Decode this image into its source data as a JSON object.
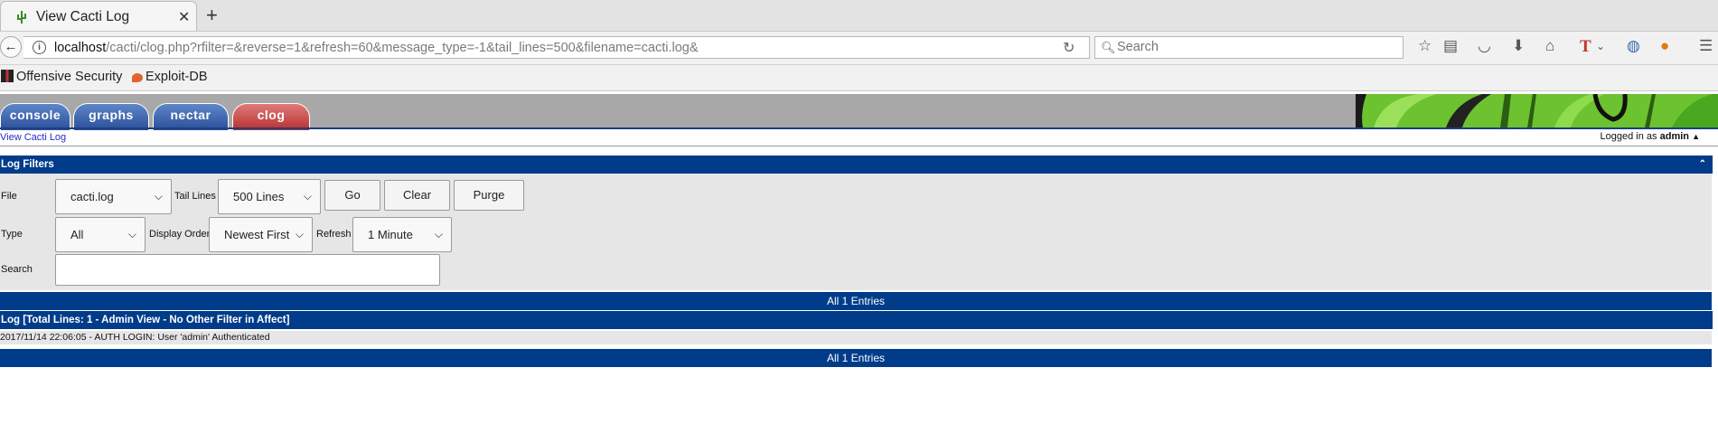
{
  "browser": {
    "tab_title": "View Cacti Log",
    "new_tab": "+",
    "close": "✕",
    "url_host": "localhost",
    "url_path": "/cacti/clog.php?rfilter=&reverse=1&refresh=60&message_type=-1&tail_lines=500&filename=cacti.log&",
    "search_placeholder": "Search",
    "bookmarks": [
      "Offensive Security",
      "Exploit-DB"
    ]
  },
  "cacti": {
    "tabs": [
      "console",
      "graphs",
      "nectar",
      "clog"
    ],
    "breadcrumb": "View Cacti Log",
    "logged_in_prefix": "Logged in as",
    "user": "admin",
    "filters": {
      "title": "Log Filters",
      "file_label": "File",
      "file_value": "cacti.log",
      "tail_label": "Tail Lines",
      "tail_value": "500 Lines",
      "go": "Go",
      "clear": "Clear",
      "purge": "Purge",
      "type_label": "Type",
      "type_value": "All",
      "order_label": "Display Order",
      "order_value": "Newest First",
      "refresh_label": "Refresh",
      "refresh_value": "1 Minute",
      "search_label": "Search",
      "search_value": ""
    },
    "entries_top": "All 1 Entries",
    "log_header": "Log [Total Lines: 1 - Admin View - No Other Filter in Affect]",
    "log_lines": [
      "2017/11/14 22:06:05 - AUTH LOGIN: User 'admin' Authenticated"
    ],
    "entries_bottom": "All 1 Entries"
  }
}
